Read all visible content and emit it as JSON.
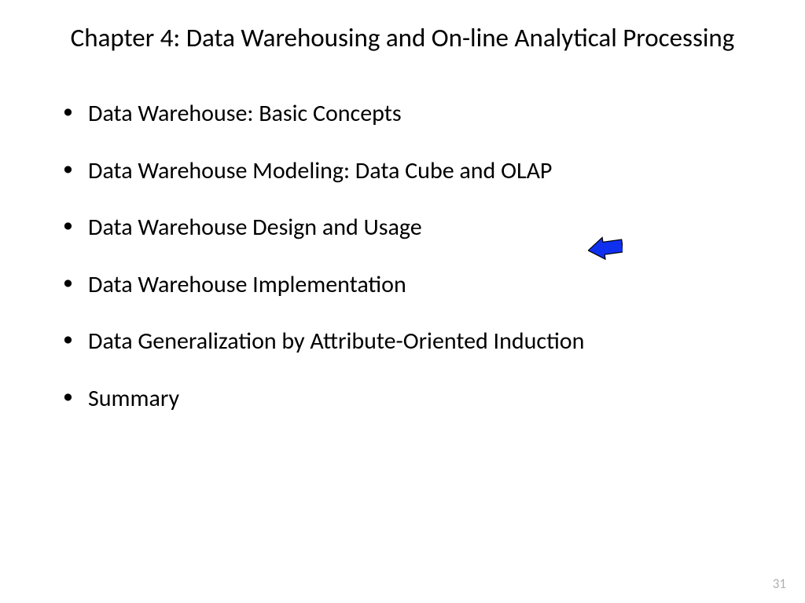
{
  "title": "Chapter 4: Data Warehousing and On-line Analytical Processing",
  "bullets": [
    "Data Warehouse: Basic Concepts",
    "Data Warehouse Modeling: Data Cube and OLAP",
    "Data Warehouse Design and Usage",
    "Data Warehouse Implementation",
    "Data Generalization by Attribute-Oriented Induction",
    "Summary"
  ],
  "page_number": "31",
  "arrow_color": "#1030f0"
}
